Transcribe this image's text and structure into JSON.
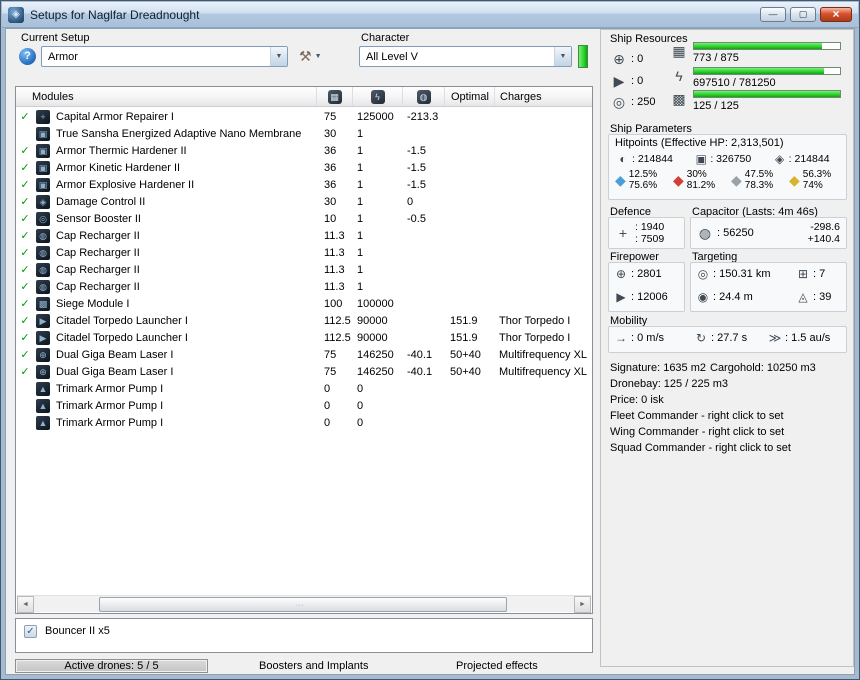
{
  "window": {
    "title": "Setups for Naglfar Dreadnought"
  },
  "colors": {
    "bar_green": "#2fd42f",
    "check_green": "#009900",
    "close_red": "#d9512c",
    "em_blue": "#4a9fd8",
    "thermal_red": "#d04038",
    "kinetic_gray": "#98a2ab",
    "explosive_yellow": "#d8b330"
  },
  "icons": {
    "app": "◈",
    "minimize": "—",
    "maximize": "▢",
    "close": "×",
    "help": "?",
    "tools": "⚒",
    "dropdown": "▼",
    "checkbox_check": "✓",
    "fitted_check": "✓",
    "turret": "⊕",
    "launcher": "▶",
    "calibration": "◎",
    "cpu": "▦",
    "powergrid": "ϟ",
    "bandwidth": "▩",
    "capacitor": "◍",
    "shield": "◐",
    "armor": "▣",
    "hull": "◈",
    "resist": "◆",
    "defence": "+",
    "range": "◎",
    "max_targets": "⊞",
    "sig_radius": "◉",
    "scan_res": "◬",
    "speed": "→",
    "align": "↻",
    "warp": "≫",
    "scroll_left": "◄",
    "scroll_right": "►"
  },
  "setup": {
    "label": "Current Setup",
    "value": "Armor"
  },
  "character": {
    "label": "Character",
    "value": "All Level V"
  },
  "resources": {
    "label": "Ship Resources",
    "turrets": "0",
    "launchers": "0",
    "calibration": "250",
    "cpu": {
      "text": "773 / 875",
      "pct": 88
    },
    "powergrid": {
      "text": "697510 / 781250",
      "pct": 89
    },
    "bandwidth": {
      "text": "125 / 125",
      "pct": 100
    }
  },
  "parameters": {
    "label": "Ship Parameters",
    "hitpoints_title": "Hitpoints (Effective HP: 2,313,501)",
    "hp": {
      "shield": "214844",
      "armor": "326750",
      "hull": "214844"
    },
    "resists": [
      {
        "type": "em",
        "shield": "12.5%",
        "armor": "75.6%"
      },
      {
        "type": "thermal",
        "shield": "30%",
        "armor": "81.2%"
      },
      {
        "type": "kinetic",
        "shield": "47.5%",
        "armor": "78.3%"
      },
      {
        "type": "explosive",
        "shield": "56.3%",
        "armor": "74%"
      }
    ],
    "defence": {
      "label": "Defence",
      "values": [
        "1940",
        "7509"
      ]
    },
    "capacitor": {
      "label": "Capacitor (Lasts: 4m 46s)",
      "amount": "56250",
      "drain": "-298.6",
      "recharge": "+140.4"
    },
    "firepower": {
      "label": "Firepower",
      "dps": "2801",
      "volley": "12006"
    },
    "targeting": {
      "label": "Targeting",
      "range": "150.31 km",
      "max_targets": "7",
      "sig_radius": "24.4 m",
      "scan_res": "39"
    },
    "mobility": {
      "label": "Mobility",
      "speed": "0 m/s",
      "align_time": "27.7 s",
      "warp_speed": "1.5 au/s"
    },
    "info": {
      "signature": "Signature: 1635 m2",
      "cargohold": "Cargohold: 10250 m3",
      "dronebay": "Dronebay: 125 / 225 m3",
      "price": "Price: 0 isk",
      "fleet": "Fleet Commander - right click to set",
      "wing": "Wing Commander - right click to set",
      "squad": "Squad Commander - right click to set"
    }
  },
  "modules_table": {
    "header_modules": "Modules",
    "header_optimal": "Optimal",
    "header_charges": "Charges",
    "rows": [
      {
        "fitted": true,
        "icon": "+",
        "name": "Capital Armor Repairer I",
        "cpu": "75",
        "pg": "125000",
        "cap": "-213.3",
        "optimal": "",
        "charge": ""
      },
      {
        "fitted": false,
        "icon": "▣",
        "name": "True Sansha Energized Adaptive Nano Membrane",
        "cpu": "30",
        "pg": "1",
        "cap": "",
        "optimal": "",
        "charge": ""
      },
      {
        "fitted": true,
        "icon": "▣",
        "name": "Armor Thermic Hardener II",
        "cpu": "36",
        "pg": "1",
        "cap": "-1.5",
        "optimal": "",
        "charge": ""
      },
      {
        "fitted": true,
        "icon": "▣",
        "name": "Armor Kinetic Hardener II",
        "cpu": "36",
        "pg": "1",
        "cap": "-1.5",
        "optimal": "",
        "charge": ""
      },
      {
        "fitted": true,
        "icon": "▣",
        "name": "Armor Explosive Hardener II",
        "cpu": "36",
        "pg": "1",
        "cap": "-1.5",
        "optimal": "",
        "charge": ""
      },
      {
        "fitted": true,
        "icon": "◈",
        "name": "Damage Control II",
        "cpu": "30",
        "pg": "1",
        "cap": "0",
        "optimal": "",
        "charge": ""
      },
      {
        "fitted": true,
        "icon": "◎",
        "name": "Sensor Booster II",
        "cpu": "10",
        "pg": "1",
        "cap": "-0.5",
        "optimal": "",
        "charge": ""
      },
      {
        "fitted": true,
        "icon": "◍",
        "name": "Cap Recharger II",
        "cpu": "11.3",
        "pg": "1",
        "cap": "",
        "optimal": "",
        "charge": ""
      },
      {
        "fitted": true,
        "icon": "◍",
        "name": "Cap Recharger II",
        "cpu": "11.3",
        "pg": "1",
        "cap": "",
        "optimal": "",
        "charge": ""
      },
      {
        "fitted": true,
        "icon": "◍",
        "name": "Cap Recharger II",
        "cpu": "11.3",
        "pg": "1",
        "cap": "",
        "optimal": "",
        "charge": ""
      },
      {
        "fitted": true,
        "icon": "◍",
        "name": "Cap Recharger II",
        "cpu": "11.3",
        "pg": "1",
        "cap": "",
        "optimal": "",
        "charge": ""
      },
      {
        "fitted": true,
        "icon": "▩",
        "name": "Siege Module I",
        "cpu": "100",
        "pg": "100000",
        "cap": "",
        "optimal": "",
        "charge": ""
      },
      {
        "fitted": true,
        "icon": "▶",
        "name": "Citadel Torpedo Launcher I",
        "cpu": "112.5",
        "pg": "90000",
        "cap": "",
        "optimal": "151.9",
        "charge": "Thor Torpedo I"
      },
      {
        "fitted": true,
        "icon": "▶",
        "name": "Citadel Torpedo Launcher I",
        "cpu": "112.5",
        "pg": "90000",
        "cap": "",
        "optimal": "151.9",
        "charge": "Thor Torpedo I"
      },
      {
        "fitted": true,
        "icon": "⊕",
        "name": "Dual Giga Beam Laser I",
        "cpu": "75",
        "pg": "146250",
        "cap": "-40.1",
        "optimal": "50+40",
        "charge": "Multifrequency XL"
      },
      {
        "fitted": true,
        "icon": "⊕",
        "name": "Dual Giga Beam Laser I",
        "cpu": "75",
        "pg": "146250",
        "cap": "-40.1",
        "optimal": "50+40",
        "charge": "Multifrequency XL"
      },
      {
        "fitted": false,
        "icon": "▲",
        "name": "Trimark Armor Pump I",
        "cpu": "0",
        "pg": "0",
        "cap": "",
        "optimal": "",
        "charge": ""
      },
      {
        "fitted": false,
        "icon": "▲",
        "name": "Trimark Armor Pump I",
        "cpu": "0",
        "pg": "0",
        "cap": "",
        "optimal": "",
        "charge": ""
      },
      {
        "fitted": false,
        "icon": "▲",
        "name": "Trimark Armor Pump I",
        "cpu": "0",
        "pg": "0",
        "cap": "",
        "optimal": "",
        "charge": ""
      }
    ]
  },
  "drones": {
    "checked": true,
    "label": "Bouncer II x5"
  },
  "footer": {
    "active_drones": "Active drones: 5 / 5",
    "boosters": "Boosters and Implants",
    "projected": "Projected effects"
  }
}
